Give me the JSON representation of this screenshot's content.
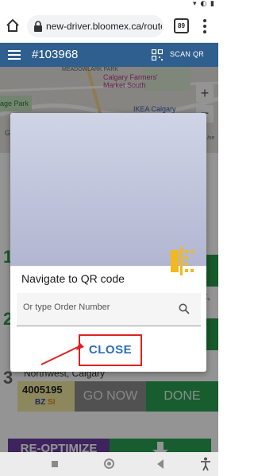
{
  "browser": {
    "url": "new-driver.bloomex.ca/route",
    "tab_count": "89"
  },
  "header": {
    "title": "#103968",
    "scan_label": "SCAN QR"
  },
  "map": {
    "labels": {
      "meadowlark": "MEADOWLARK PARK",
      "farmers_market": "Calgary Farmers' Market South",
      "park": "age Park",
      "ikea": "IKEA Calgary",
      "use": "Use",
      "g": "G"
    },
    "zoom_in": "+",
    "zoom_out": "−"
  },
  "list": {
    "stop_numbers": [
      "1",
      "2",
      "3"
    ],
    "address_fragment": "Northwest, Calgary",
    "side_text": "t,",
    "order": {
      "number": "4005195",
      "tag_bz": "BZ",
      "tag_si": "SI"
    },
    "go_now_label": "GO NOW",
    "done_label": "DONE",
    "reoptimize_label": "RE-OPTIMIZE"
  },
  "dialog": {
    "title": "Navigate to QR code",
    "order_placeholder": "Or type Order Number",
    "close_label": "CLOSE"
  },
  "colors": {
    "header_bg": "#2f5f8e",
    "done_green": "#2aa052",
    "go_now_grey": "#8c8c8c",
    "close_text": "#2a6fc0",
    "highlight_red": "#e02020",
    "reoptimize_purple": "#6b3fa0"
  }
}
